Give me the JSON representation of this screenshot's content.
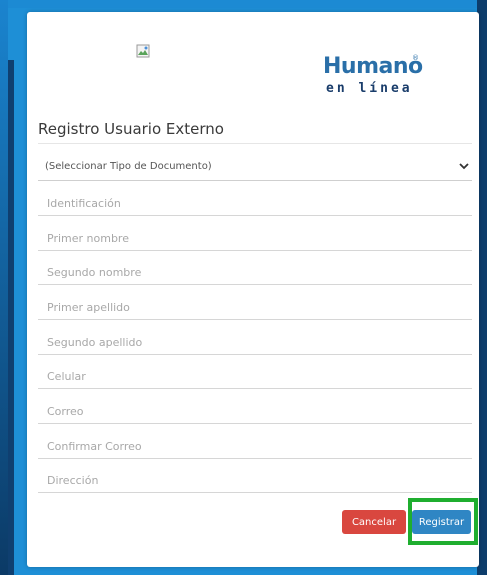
{
  "header": {
    "logo_main": "Humano",
    "logo_registered": "®",
    "logo_sub": "en línea"
  },
  "form": {
    "title": "Registro Usuario Externo",
    "document_type_select": "(Seleccionar Tipo de Documento)",
    "fields": [
      {
        "key": "identificacion",
        "placeholder": "Identificación"
      },
      {
        "key": "primer_nombre",
        "placeholder": "Primer nombre"
      },
      {
        "key": "segundo_nombre",
        "placeholder": "Segundo nombre"
      },
      {
        "key": "primer_apellido",
        "placeholder": "Primer apellido"
      },
      {
        "key": "segundo_apellido",
        "placeholder": "Segundo apellido"
      },
      {
        "key": "celular",
        "placeholder": "Celular"
      },
      {
        "key": "correo",
        "placeholder": "Correo"
      },
      {
        "key": "confirmar_correo",
        "placeholder": "Confirmar Correo"
      },
      {
        "key": "direccion",
        "placeholder": "Dirección"
      }
    ]
  },
  "actions": {
    "cancel_label": "Cancelar",
    "register_label": "Registrar"
  },
  "colors": {
    "background": "#1e8fd6",
    "brand_blue": "#2a6fa8",
    "cancel": "#d9473f",
    "register": "#2f86c4",
    "highlight": "#1fae2f"
  },
  "icons": {
    "broken_image": "broken-image-icon",
    "select_arrow": "chevron-down-icon"
  }
}
